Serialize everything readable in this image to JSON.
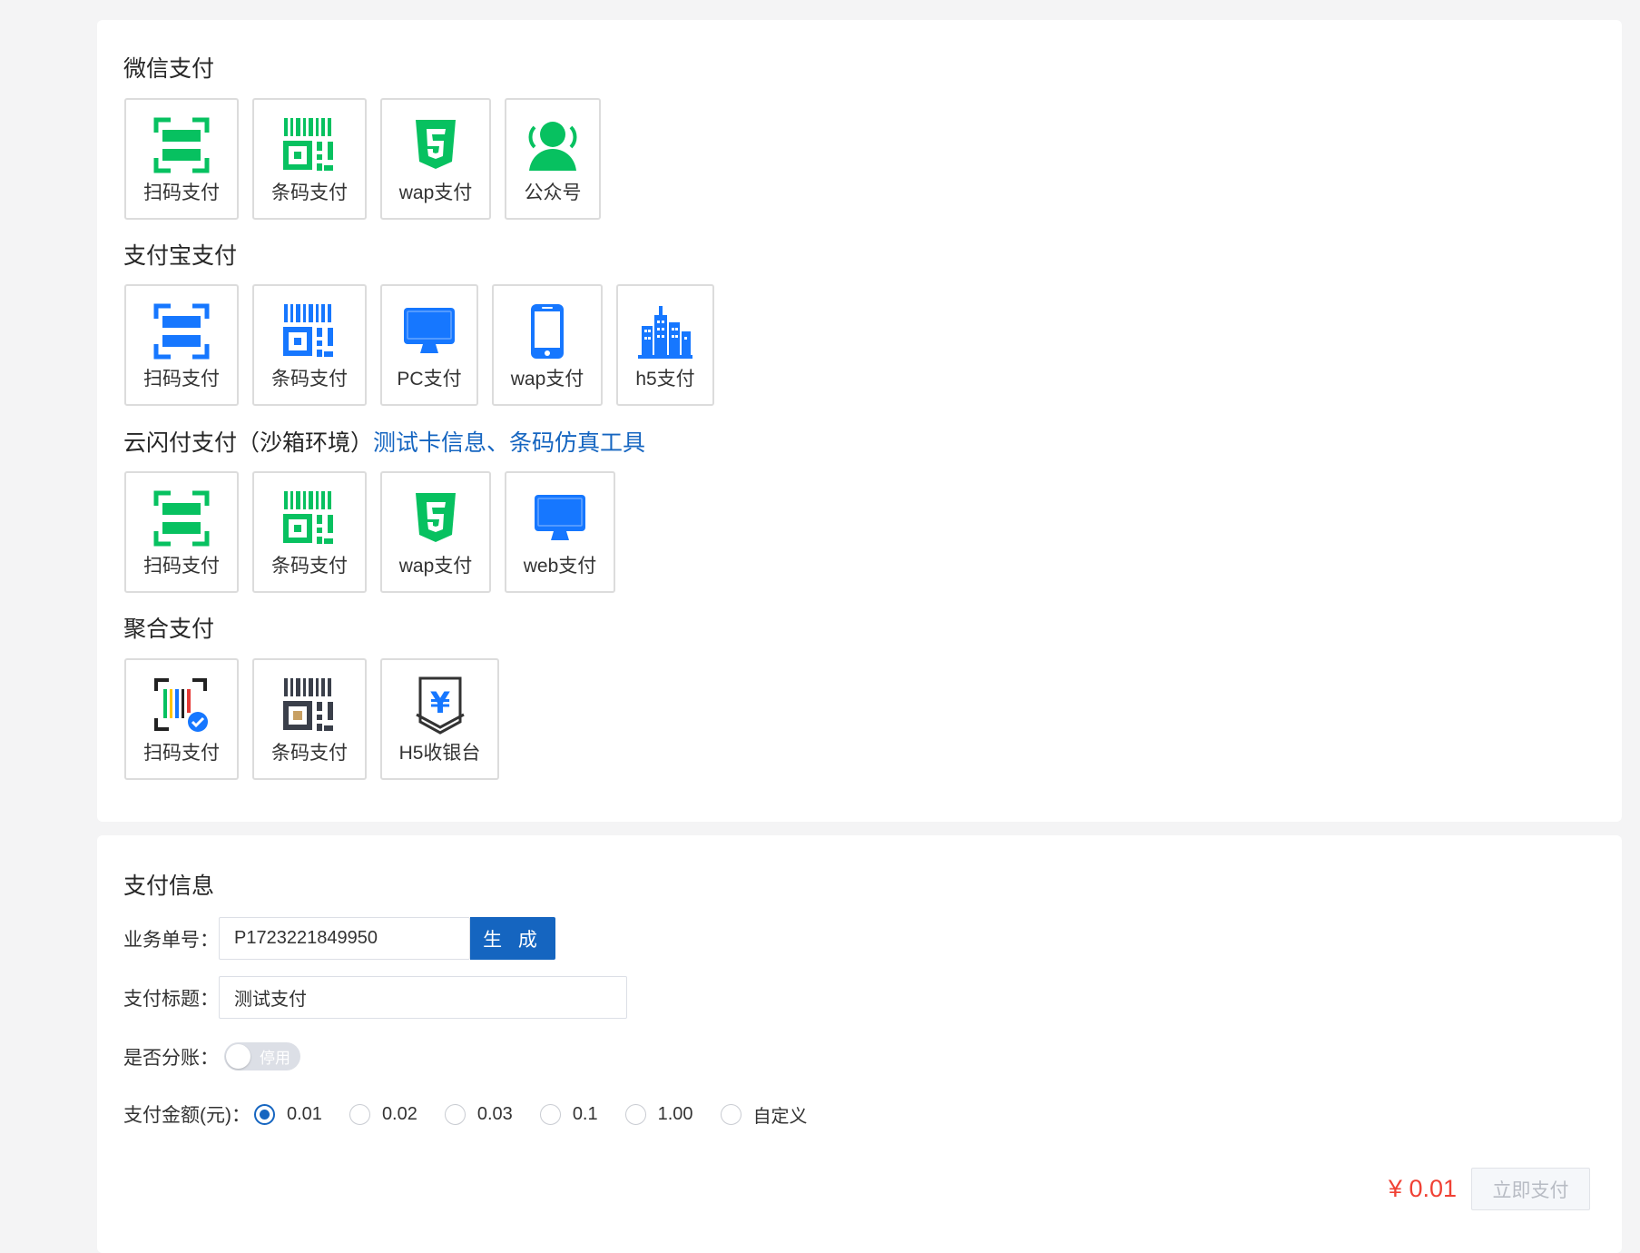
{
  "colors": {
    "wechat_green": "#07c160",
    "alipay_blue": "#1677ff",
    "link_blue": "#1565c0",
    "amount_red": "#f04134"
  },
  "sections": {
    "wechat": {
      "title": "微信支付",
      "items": [
        {
          "label": "扫码支付",
          "icon": "scan-icon"
        },
        {
          "label": "条码支付",
          "icon": "barcode-icon"
        },
        {
          "label": "wap支付",
          "icon": "html5-icon"
        },
        {
          "label": "公众号",
          "icon": "user-group-icon"
        }
      ]
    },
    "alipay": {
      "title": "支付宝支付",
      "items": [
        {
          "label": "扫码支付",
          "icon": "scan-icon"
        },
        {
          "label": "条码支付",
          "icon": "barcode-icon"
        },
        {
          "label": "PC支付",
          "icon": "monitor-icon"
        },
        {
          "label": "wap支付",
          "icon": "phone-icon"
        },
        {
          "label": "h5支付",
          "icon": "city-icon"
        }
      ]
    },
    "unionpay": {
      "title": "云闪付支付（沙箱环境）",
      "link_test_card": "测试卡信息",
      "separator": "、",
      "link_barcode_tool": "条码仿真工具",
      "items": [
        {
          "label": "扫码支付",
          "icon": "scan-icon"
        },
        {
          "label": "条码支付",
          "icon": "barcode-icon"
        },
        {
          "label": "wap支付",
          "icon": "html5-icon"
        },
        {
          "label": "web支付",
          "icon": "monitor-icon"
        }
      ]
    },
    "aggregate": {
      "title": "聚合支付",
      "items": [
        {
          "label": "扫码支付",
          "icon": "scan-check-icon"
        },
        {
          "label": "条码支付",
          "icon": "barcode-icon"
        },
        {
          "label": "H5收银台",
          "icon": "yen-icon"
        }
      ]
    }
  },
  "payment_info": {
    "title": "支付信息",
    "order_no_label": "业务单号：",
    "order_no_value": "P1723221849950",
    "generate_label": "生 成",
    "subject_label": "支付标题：",
    "subject_value": "测试支付",
    "split_label": "是否分账：",
    "split_status": "停用",
    "amount_label": "支付金额(元)：",
    "amount_options": [
      "0.01",
      "0.02",
      "0.03",
      "0.1",
      "1.00",
      "自定义"
    ],
    "amount_selected": "0.01",
    "total_display": "¥ 0.01",
    "pay_button": "立即支付"
  }
}
